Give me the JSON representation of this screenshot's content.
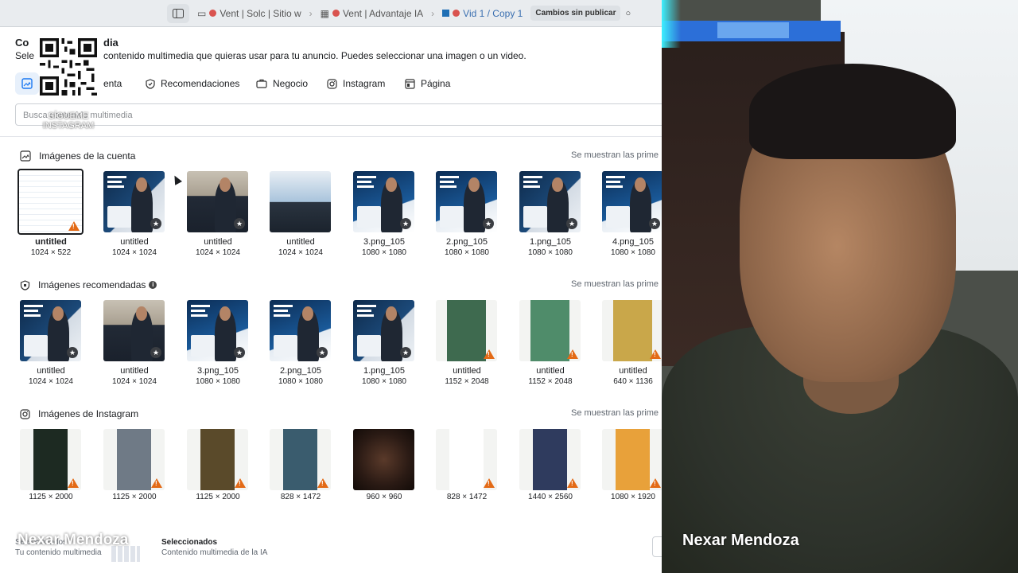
{
  "browser": {
    "tabs": [
      {
        "label": "Vent | Solc | Sitio w"
      },
      {
        "label": "Vent | Advantaje IA"
      },
      {
        "label": "Vid 1 / Copy 1"
      }
    ],
    "status": "Cambios sin publicar"
  },
  "modal": {
    "title_start": "Co",
    "title_end": "dia",
    "subtitle_start": "Sele",
    "subtitle_end": "contenido multimedia que quieras usar para tu anuncio. Puedes seleccionar una imagen o un video.",
    "tab_fragment": "enta",
    "tabs": [
      {
        "label": "Recomendaciones",
        "icon": "shield-icon"
      },
      {
        "label": "Negocio",
        "icon": "briefcase-icon"
      },
      {
        "label": "Instagram",
        "icon": "instagram-icon"
      },
      {
        "label": "Página",
        "icon": "page-icon"
      }
    ],
    "search_value": "Busca contenido multimedia",
    "qr_label": "SÍGUEME INSTAGRAM"
  },
  "sections": {
    "account": {
      "title": "Imágenes de la cuenta",
      "right": "Se muestran las prime",
      "items": [
        {
          "name": "untitled",
          "dims": "1024 × 522",
          "badge": "warn",
          "style": "table",
          "bold": true
        },
        {
          "name": "untitled",
          "dims": "1024 × 1024",
          "badge": "star",
          "style": "promo"
        },
        {
          "name": "untitled",
          "dims": "1024 × 1024",
          "badge": "star",
          "style": "suit"
        },
        {
          "name": "untitled",
          "dims": "1024 × 1024",
          "badge": "",
          "style": "laptop"
        },
        {
          "name": "3.png_105",
          "dims": "1080 × 1080",
          "badge": "star",
          "style": "blue"
        },
        {
          "name": "2.png_105",
          "dims": "1080 × 1080",
          "badge": "star",
          "style": "blue"
        },
        {
          "name": "1.png_105",
          "dims": "1080 × 1080",
          "badge": "star",
          "style": "promo"
        },
        {
          "name": "4.png_105",
          "dims": "1080 × 1080",
          "badge": "star",
          "style": "blue"
        }
      ]
    },
    "recommended": {
      "title": "Imágenes recomendadas",
      "right": "Se muestran las prime",
      "items": [
        {
          "name": "untitled",
          "dims": "1024 × 1024",
          "badge": "star",
          "style": "promo"
        },
        {
          "name": "untitled",
          "dims": "1024 × 1024",
          "badge": "star",
          "style": "suit"
        },
        {
          "name": "3.png_105",
          "dims": "1080 × 1080",
          "badge": "star",
          "style": "blue"
        },
        {
          "name": "2.png_105",
          "dims": "1080 × 1080",
          "badge": "star",
          "style": "blue"
        },
        {
          "name": "1.png_105",
          "dims": "1080 × 1080",
          "badge": "star",
          "style": "promo"
        },
        {
          "name": "untitled",
          "dims": "1152 × 2048",
          "badge": "warn",
          "style": "green"
        },
        {
          "name": "untitled",
          "dims": "1152 × 2048",
          "badge": "warn",
          "style": "green2"
        },
        {
          "name": "untitled",
          "dims": "640 × 1136",
          "badge": "warn",
          "style": "yellow"
        }
      ]
    },
    "instagram": {
      "title": "Imágenes de Instagram",
      "right": "Se muestran las prime",
      "items": [
        {
          "dims": "1125 × 2000",
          "badge": "warn",
          "style": "phone"
        },
        {
          "dims": "1125 × 2000",
          "badge": "warn",
          "style": "keyboard"
        },
        {
          "dims": "1125 × 2000",
          "badge": "warn",
          "style": "desk"
        },
        {
          "dims": "828 × 1472",
          "badge": "warn",
          "style": "poster"
        },
        {
          "dims": "960 × 960",
          "badge": "",
          "style": "dark"
        },
        {
          "dims": "828 × 1472",
          "badge": "warn",
          "style": "whitepage"
        },
        {
          "dims": "1440 × 2560",
          "badge": "warn",
          "style": "crowd"
        },
        {
          "dims": "1080 × 1920",
          "badge": "warn",
          "style": "orange"
        }
      ]
    }
  },
  "footer": {
    "left_title": "Seleccionados",
    "left_sub": "Tu contenido multimedia",
    "mid_title": "Seleccionados",
    "mid_sub": "Contenido multimedia de la IA"
  },
  "webcam": {
    "name_overlay": "Nexar Mendoza",
    "name_overlay_left": "Nexar Mendoza"
  },
  "colors": {
    "accent": "#1877f2",
    "warning": "#e36a16",
    "star_badge": "#3a3d42"
  }
}
